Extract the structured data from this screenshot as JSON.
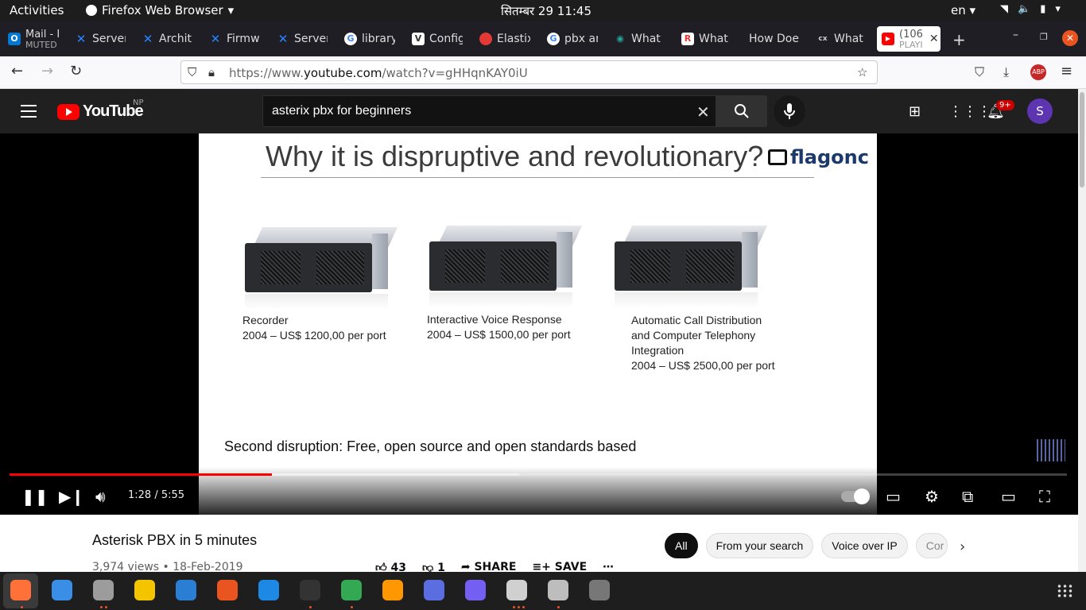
{
  "system": {
    "activities": "Activities",
    "app_name": "Firefox Web Browser",
    "clock": "सितम्बर 29  11:45",
    "lang": "en"
  },
  "tabs": [
    {
      "label": "Mail - I",
      "sub": "MUTED",
      "color": "#0078d4",
      "glyph": "O"
    },
    {
      "label": "Server",
      "color": "#2684ff",
      "glyph": "✕"
    },
    {
      "label": "Archit",
      "color": "#2684ff",
      "glyph": "✕"
    },
    {
      "label": "Firmw",
      "color": "#2684ff",
      "glyph": "✕"
    },
    {
      "label": "Server",
      "color": "#2684ff",
      "glyph": "✕"
    },
    {
      "label": "library",
      "color": "#4285f4",
      "glyph": "G"
    },
    {
      "label": "Config",
      "color": "#ffffff",
      "glyph": "V"
    },
    {
      "label": "Elastix",
      "color": "#e53935",
      "glyph": "●"
    },
    {
      "label": "pbx ar",
      "color": "#4285f4",
      "glyph": "G"
    },
    {
      "label": "What i",
      "color": "#26a69a",
      "glyph": "◉"
    },
    {
      "label": "What i",
      "color": "#e53935",
      "glyph": "R"
    },
    {
      "label": "How Doe",
      "color": "#555555",
      "glyph": ""
    },
    {
      "label": "What i",
      "color": "#666666",
      "glyph": "cx"
    },
    {
      "label": "(106",
      "sub": "PLAYI",
      "color": "#ff0000",
      "glyph": "▶"
    }
  ],
  "url": {
    "prefix": "https://www.",
    "domain": "youtube.com",
    "path": "/watch?v=gHHqnKAY0iU"
  },
  "youtube": {
    "wordmark": "YouTube",
    "region": "NP",
    "search_value": "asterix pbx for beginners",
    "notif_badge": "9+",
    "avatar_letter": "S"
  },
  "slide": {
    "title": "Why it is dispruptive and revolutionary?",
    "brand": "flagonc",
    "items": [
      {
        "lines": [
          "Recorder",
          "2004 – US$ 1200,00 per port"
        ]
      },
      {
        "lines": [
          "Interactive Voice Response",
          "2004 – US$ 1500,00 per port"
        ]
      },
      {
        "lines": [
          "Automatic Call Distribution",
          "and Computer Telephony",
          "Integration",
          "2004 – US$ 2500,00 per port"
        ]
      }
    ],
    "footer": "Second disruption: Free, open source and open standards based"
  },
  "player": {
    "time": "1:28 / 5:55",
    "progress": 0.248,
    "buffered": 0.482
  },
  "video": {
    "title": "Asterisk PBX in 5 minutes",
    "views_date": "3,974 views • 18-Feb-2019",
    "likes": "43",
    "dislikes": "1",
    "share": "SHARE",
    "save": "SAVE"
  },
  "chips": [
    "All",
    "From your search",
    "Voice over IP",
    "Cor"
  ],
  "dock": [
    {
      "name": "firefox",
      "color": "#ff7139"
    },
    {
      "name": "thunderbird",
      "color": "#3a8ee6"
    },
    {
      "name": "files",
      "color": "#9c9c9c"
    },
    {
      "name": "rhythmbox",
      "color": "#f5c400"
    },
    {
      "name": "writer",
      "color": "#2a7fd4"
    },
    {
      "name": "software",
      "color": "#e95420"
    },
    {
      "name": "help",
      "color": "#1e88e5"
    },
    {
      "name": "terminal",
      "color": "#333333"
    },
    {
      "name": "chrome",
      "color": "#34a853"
    },
    {
      "name": "sublime",
      "color": "#ff9800"
    },
    {
      "name": "screenshot",
      "color": "#5b6ee1"
    },
    {
      "name": "viber",
      "color": "#7360f2"
    },
    {
      "name": "impress",
      "color": "#d0d0d0"
    },
    {
      "name": "viewer",
      "color": "#bdbdbd"
    },
    {
      "name": "disk",
      "color": "#777777"
    }
  ]
}
